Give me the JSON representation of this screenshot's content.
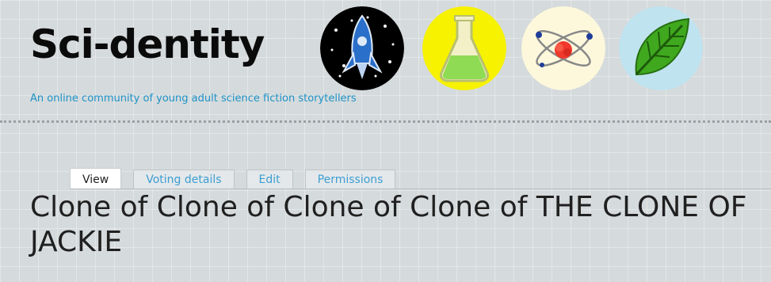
{
  "site": {
    "name": "Sci-dentity",
    "slogan": "An online community of young adult science fiction storytellers"
  },
  "logos": [
    {
      "icon": "rocket-icon",
      "background": "#000000"
    },
    {
      "icon": "flask-icon",
      "background": "#f6f200"
    },
    {
      "icon": "atom-icon",
      "background": "#fdf8dc"
    },
    {
      "icon": "leaf-icon",
      "background": "#bfe3ef"
    }
  ],
  "tabs": [
    {
      "label": "View",
      "active": true
    },
    {
      "label": "Voting details",
      "active": false
    },
    {
      "label": "Edit",
      "active": false
    },
    {
      "label": "Permissions",
      "active": false
    }
  ],
  "page": {
    "title": "Clone of Clone of Clone of Clone of THE CLONE OF JACKIE"
  },
  "colors": {
    "slogan": "#1f93c7",
    "tab_link": "#3d9ed2",
    "title": "#202020"
  }
}
